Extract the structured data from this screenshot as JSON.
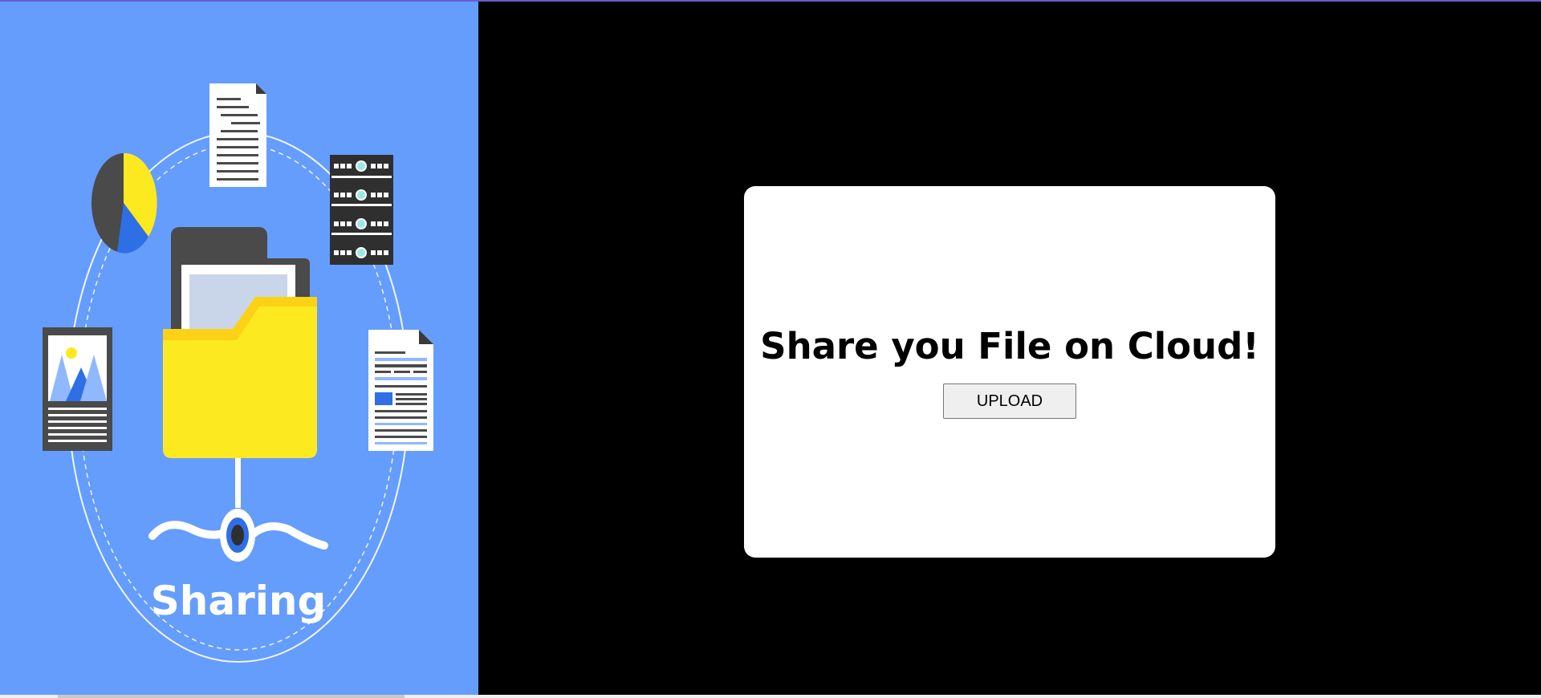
{
  "hero": {
    "image_text": "Sharing",
    "colors": {
      "background": "#659dfd",
      "folder": "#fde91f",
      "folder_tab": "#fcd116",
      "dark": "#4a4a4a",
      "accent_blue": "#2e6fe6",
      "white": "#ffffff"
    },
    "icons": [
      "pie-chart-icon",
      "document-icon",
      "server-rack-icon",
      "image-file-icon",
      "folder-icon",
      "report-file-icon",
      "network-node-icon"
    ]
  },
  "card": {
    "heading": "Share you File on Cloud!",
    "upload_label": "UPLOAD"
  },
  "colors": {
    "page_background": "#000000",
    "card_background": "#ffffff",
    "top_border": "#6a5acd"
  }
}
